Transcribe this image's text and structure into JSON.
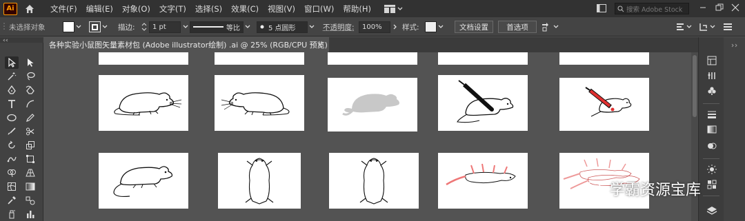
{
  "app": {
    "logo_text": "Ai"
  },
  "menu": {
    "items": [
      "文件(F)",
      "编辑(E)",
      "对象(O)",
      "文字(T)",
      "选择(S)",
      "效果(C)",
      "视图(V)",
      "窗口(W)",
      "帮助(H)"
    ]
  },
  "search": {
    "placeholder": "搜索 Adobe Stock"
  },
  "control": {
    "selection_status": "未选择对象",
    "stroke_label": "描边:",
    "stroke_weight": "1 pt",
    "profile_label": "等比",
    "brush_label": "5 点圆形",
    "opacity_label": "不透明度:",
    "opacity_value": "100%",
    "style_label": "样式:",
    "doc_setup_button": "文档设置",
    "preferences_button": "首选项"
  },
  "document": {
    "tab_title": "各种实验小鼠图矢量素材包 (Adobe illustrator绘制) .ai @ 25% (RGB/CPU 预览)",
    "close": "×"
  },
  "watermark": {
    "text": "学霸资源宝库"
  },
  "colors": {
    "menubar": "#323232",
    "panel": "#444444",
    "canvas": "#535353",
    "artboard": "#ffffff",
    "accent_red": "#e03030",
    "logo_orange": "#ff9a00"
  },
  "artboards": [
    {
      "row": 1,
      "col": 1,
      "drawing": "mouse-outline-right"
    },
    {
      "row": 1,
      "col": 2,
      "drawing": "mouse-outline-left"
    },
    {
      "row": 1,
      "col": 3,
      "drawing": "mouse-silhouette-gray"
    },
    {
      "row": 1,
      "col": 4,
      "drawing": "mouse-with-syringe-black"
    },
    {
      "row": 1,
      "col": 5,
      "drawing": "mouse-with-syringe-red"
    },
    {
      "row": 2,
      "col": 1,
      "drawing": "mouse-side-view"
    },
    {
      "row": 2,
      "col": 2,
      "drawing": "mouse-top-view"
    },
    {
      "row": 2,
      "col": 3,
      "drawing": "mouse-top-view-2"
    },
    {
      "row": 2,
      "col": 4,
      "drawing": "mouse-on-back"
    },
    {
      "row": 2,
      "col": 5,
      "drawing": "mice-group"
    }
  ]
}
